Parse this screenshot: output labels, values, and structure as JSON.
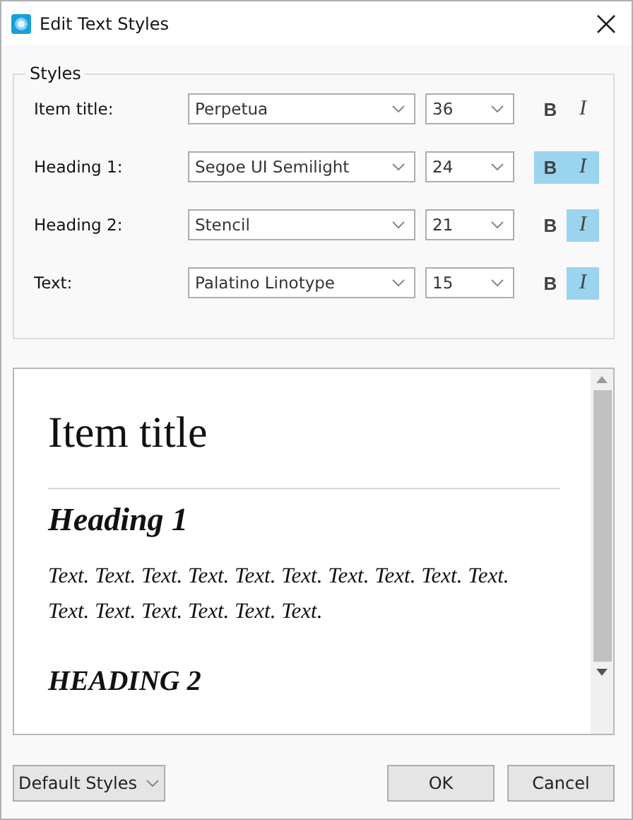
{
  "window": {
    "title": "Edit Text Styles"
  },
  "styles_group": {
    "title": "Styles",
    "rows": [
      {
        "label": "Item title:",
        "font": "Perpetua",
        "size": "36",
        "bold_label": "B",
        "bold": false,
        "italic_label": "I",
        "italic": false
      },
      {
        "label": "Heading 1:",
        "font": "Segoe UI Semilight",
        "size": "24",
        "bold_label": "B",
        "bold": true,
        "italic_label": "I",
        "italic": true
      },
      {
        "label": "Heading 2:",
        "font": "Stencil",
        "size": "21",
        "bold_label": "B",
        "bold": false,
        "italic_label": "I",
        "italic": true
      },
      {
        "label": "Text:",
        "font": "Palatino Linotype",
        "size": "15",
        "bold_label": "B",
        "bold": false,
        "italic_label": "I",
        "italic": true
      }
    ]
  },
  "preview": [
    {
      "kind": "title",
      "text": "Item title"
    },
    {
      "kind": "heading1",
      "text": "Heading 1"
    },
    {
      "kind": "paragraph",
      "text": "Text. Text. Text. Text. Text. Text. Text. Text. Text. Text. Text. Text. Text. Text. Text. Text."
    },
    {
      "kind": "heading2",
      "text": "HEADING 2"
    }
  ],
  "buttons": {
    "defaults": "Default Styles",
    "ok": "OK",
    "cancel": "Cancel"
  }
}
